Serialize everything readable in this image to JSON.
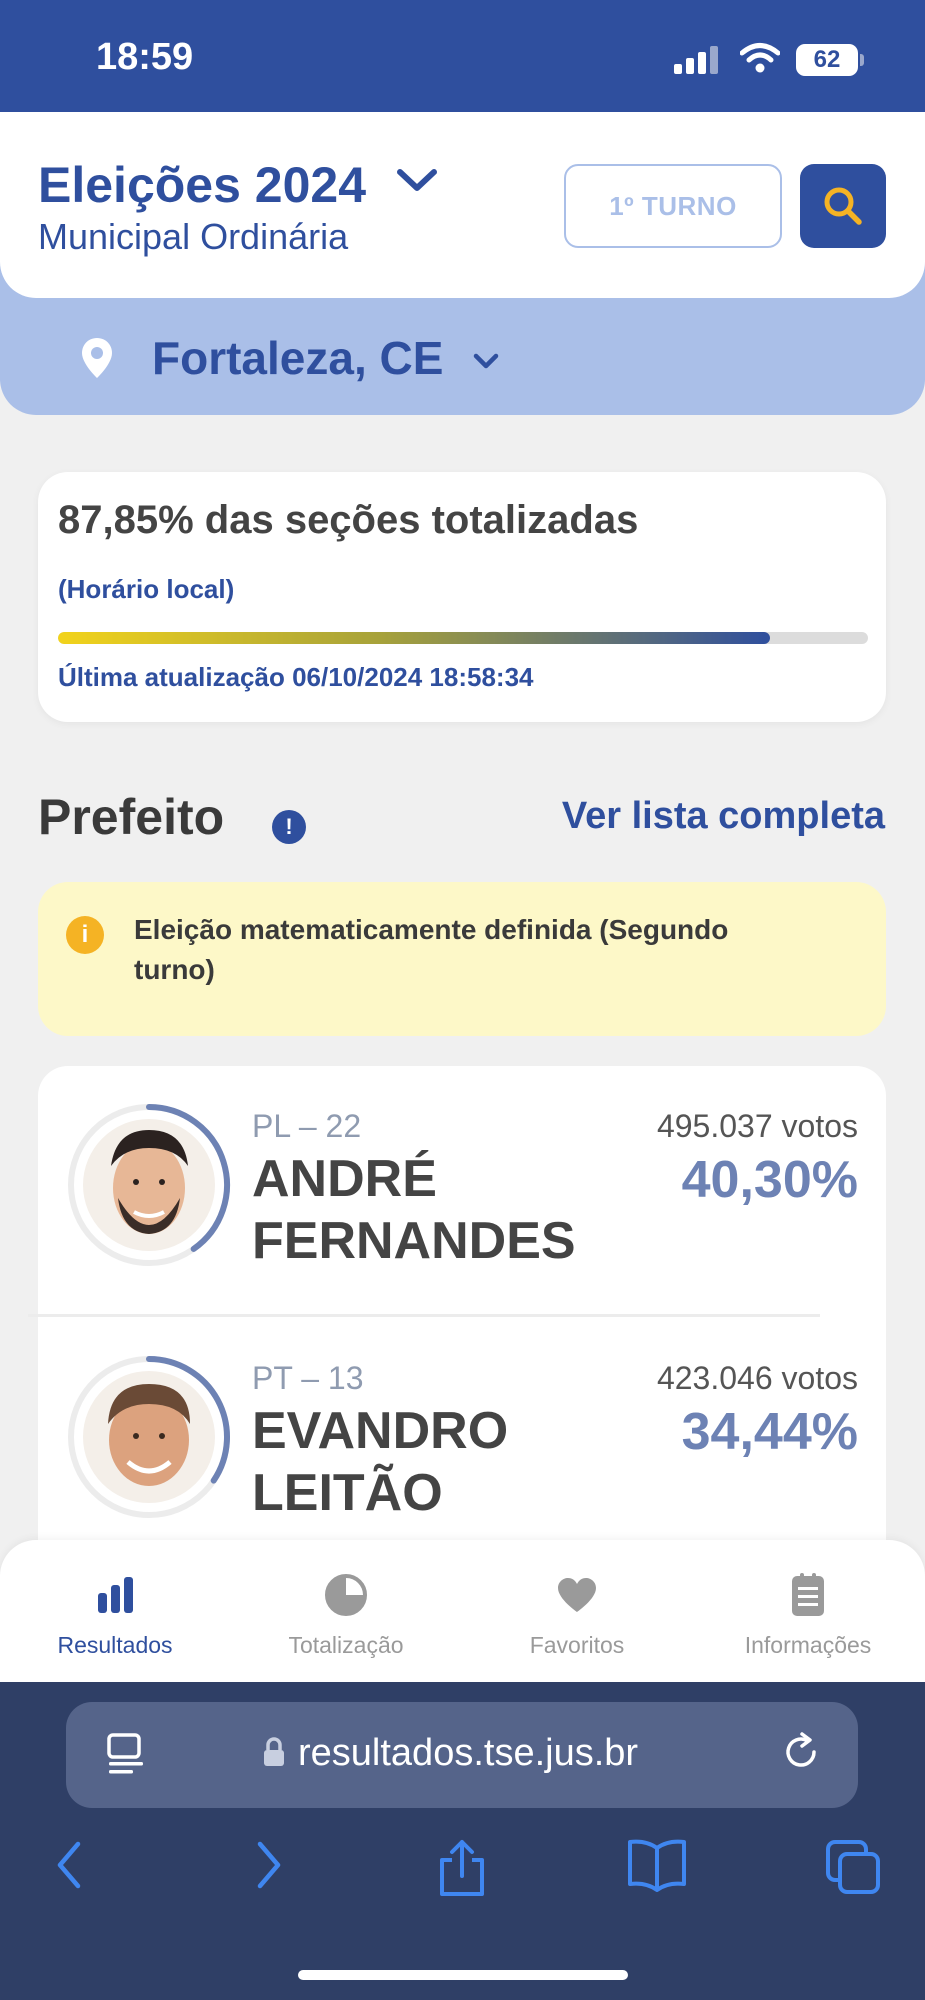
{
  "status_bar": {
    "time": "18:59",
    "battery": "62"
  },
  "header": {
    "election_title": "Eleições 2024",
    "election_subtitle": "Municipal Ordinária",
    "round_label": "1º TURNO",
    "city": "Fortaleza, CE",
    "search_icon": "search-icon",
    "location_icon": "map-pin-icon"
  },
  "progress": {
    "title": "87,85% das seções totalizadas",
    "subtitle": "(Horário local)",
    "percent": 87.85,
    "last_update": "Última atualização 06/10/2024 18:58:34"
  },
  "section": {
    "title": "Prefeito",
    "see_all": "Ver lista completa",
    "info_glyph": "!"
  },
  "notice": {
    "text": "Eleição matematicamente definida (Segundo turno)",
    "icon_glyph": "i"
  },
  "candidates": [
    {
      "party": "PL – 22",
      "name": "ANDRÉ FERNANDES",
      "votes": "495.037 votos",
      "percent": "40,30%",
      "percent_value": 40.3
    },
    {
      "party": "PT – 13",
      "name": "EVANDRO LEITÃO",
      "votes": "423.046 votos",
      "percent": "34,44%",
      "percent_value": 34.44
    }
  ],
  "tabbar": [
    {
      "label": "Resultados",
      "icon": "bar-chart-icon",
      "active": true
    },
    {
      "label": "Totalização",
      "icon": "pie-chart-icon",
      "active": false
    },
    {
      "label": "Favoritos",
      "icon": "heart-icon",
      "active": false
    },
    {
      "label": "Informações",
      "icon": "document-icon",
      "active": false
    }
  ],
  "browser": {
    "url": "resultados.tse.jus.br"
  },
  "colors": {
    "brand_blue": "#2f4f9e",
    "light_blue": "#aabfe8",
    "notice_yellow": "#fdf8c8",
    "warning_orange": "#f5b324",
    "percent_blue": "#6d82b4"
  }
}
